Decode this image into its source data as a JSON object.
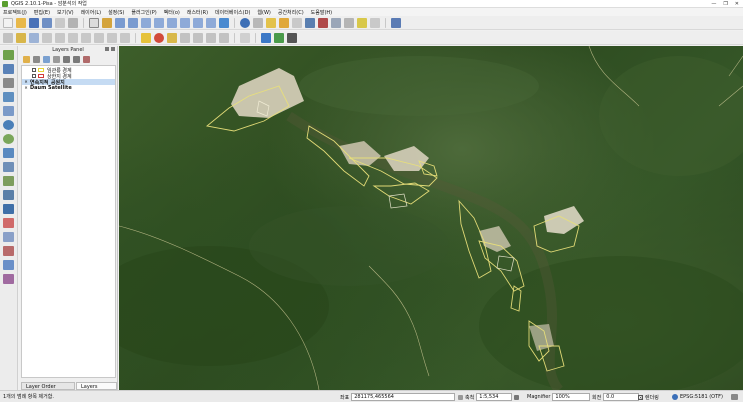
{
  "window": {
    "title": "QGIS 2.10.1-Pisa - 암분석의 작업",
    "controls": [
      "—",
      "❐",
      "✕"
    ]
  },
  "menu": [
    "프로젝트(J)",
    "편집(E)",
    "보기(V)",
    "레이어(L)",
    "설정(S)",
    "플러그인(P)",
    "벡터(o)",
    "래스터(R)",
    "데이터베이스(D)",
    "웹(W)",
    "공간처리(C)",
    "도움말(H)"
  ],
  "panel": {
    "title": "Layers Panel",
    "layers": [
      {
        "name": "임관릉 경계",
        "checked": true,
        "symbol_color": "#e6d53a"
      },
      {
        "name": "상한지 경계",
        "checked": true,
        "symbol_color": "#d23a3a"
      },
      {
        "name": "연속지적_공원지",
        "checked": true,
        "symbol_color": "#444444",
        "selected": true
      },
      {
        "name": "Daum Satellite",
        "checked": true,
        "symbol_color": ""
      }
    ],
    "tabs": [
      "Layer Order Panel",
      "Layers Panel"
    ]
  },
  "status": {
    "message": "1개의 범례 항목 제거함.",
    "coord_label": "좌표",
    "coord_value": "281175,465564",
    "scale_label": "축척",
    "scale_value": "1:5,534",
    "magnifier_label": "Magnifier",
    "magnifier_value": "100%",
    "rotation_label": "회전",
    "rotation_value": "0.0",
    "render_label": "렌더링",
    "crs": "EPSG:5181 (OTF)"
  },
  "colors": {
    "boundary_yellow": "#e9e07a",
    "boundary_white": "#f4f0d8",
    "forest": "#2f4d22",
    "cleared": "#d9d2bd"
  }
}
